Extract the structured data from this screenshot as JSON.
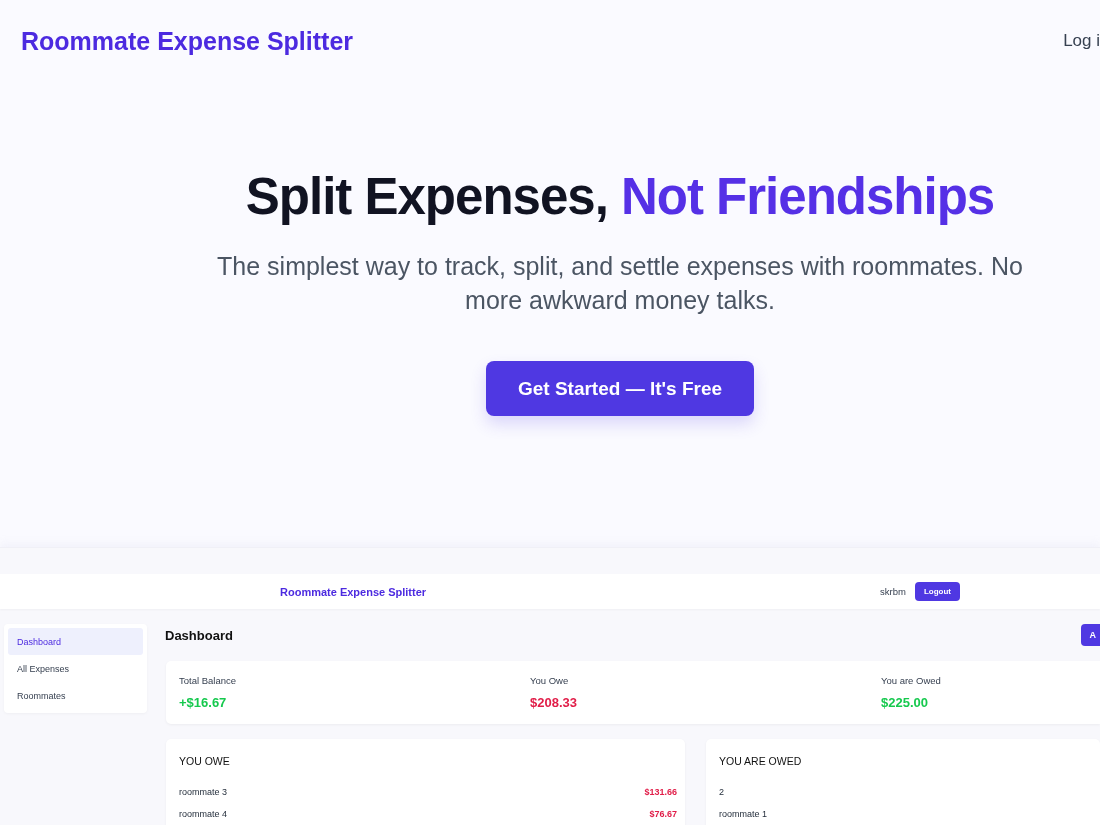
{
  "header": {
    "title": "Roommate Expense Splitter",
    "login_link": "Log i"
  },
  "hero": {
    "title": [
      {
        "text": "Split Expenses,",
        "highlight": false
      },
      {
        "text": "Not Friendships",
        "highlight": true
      }
    ],
    "subtitle": "The simplest way to track, split, and settle expenses with roommates. No more awkward money talks.",
    "cta_button": "Get Started — It's Free"
  },
  "app_preview": {
    "header": {
      "title": "Roommate Expense Splitter",
      "username": "skrbm",
      "logout_button": "Logout"
    },
    "sidebar": {
      "items": [
        {
          "label": "Dashboard",
          "selected": true
        },
        {
          "label": "All Expenses",
          "selected": false
        },
        {
          "label": "Roommates",
          "selected": false
        }
      ]
    },
    "page_title": "Dashboard",
    "add_button": "A",
    "summary": [
      {
        "label": "Total Balance",
        "value": "+$16.67",
        "color": "#16c94e"
      },
      {
        "label": "You Owe",
        "value": "$208.33",
        "color": "#e11d48"
      },
      {
        "label": "You are Owed",
        "value": "$225.00",
        "color": "#16c94e"
      }
    ],
    "balances": [
      {
        "title": "YOU OWE",
        "color": "#e11d48",
        "rows": [
          {
            "name": "roommate 3",
            "amount": "$131.66"
          },
          {
            "name": "roommate 4",
            "amount": "$76.67"
          }
        ]
      },
      {
        "title": "YOU ARE OWED",
        "rows": [
          {
            "name": "2"
          },
          {
            "name": "roommate 1"
          }
        ]
      }
    ]
  }
}
